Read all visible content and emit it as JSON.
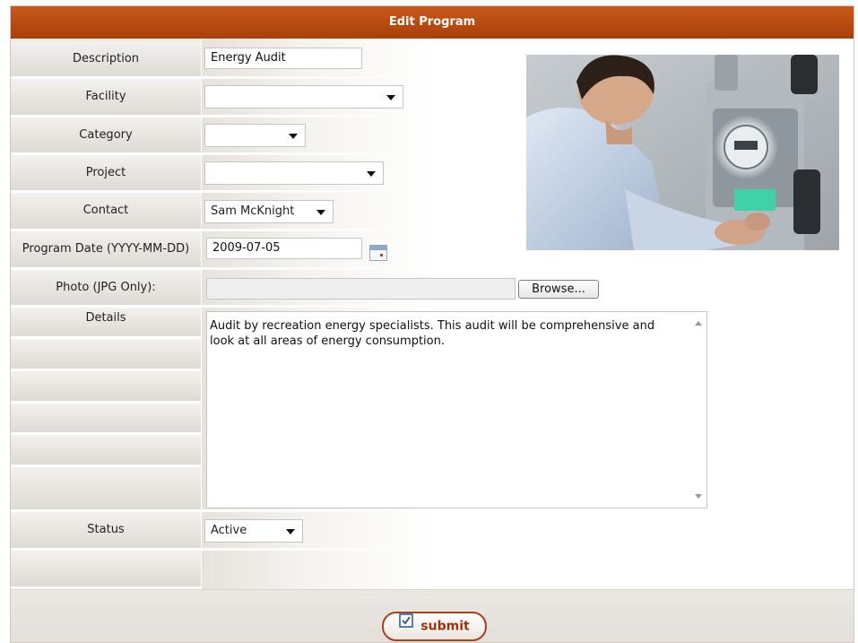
{
  "form": {
    "title": "Edit Program",
    "fields": {
      "description": {
        "label": "Description",
        "value": "Energy Audit"
      },
      "facility": {
        "label": "Facility",
        "value": ""
      },
      "category": {
        "label": "Category",
        "value": ""
      },
      "project": {
        "label": "Project",
        "value": ""
      },
      "contact": {
        "label": "Contact",
        "value": "Sam McKnight"
      },
      "program_date": {
        "label": "Program Date (YYYY-MM-DD)",
        "value": "2009-07-05"
      },
      "photo": {
        "label": "Photo (JPG Only):",
        "value": "",
        "browse_label": "Browse..."
      },
      "details": {
        "label": "Details",
        "value": "Audit by recreation energy specialists.  This audit will be comprehensive and look at all areas of energy consumption."
      },
      "status": {
        "label": "Status",
        "value": "Active"
      }
    },
    "submit_label": "submit"
  },
  "icons": {
    "calendar": "calendar-icon",
    "submit": "checkbox-icon"
  },
  "colors": {
    "header": "#b34a0f",
    "accent": "#a0300a"
  }
}
